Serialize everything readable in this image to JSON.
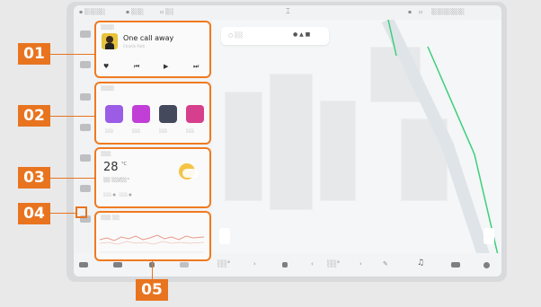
{
  "callouts": [
    "01",
    "02",
    "03",
    "04",
    "05"
  ],
  "music": {
    "song_title": "One call away",
    "artist": "Charlie Puth",
    "controls": [
      "like-icon",
      "prev-icon",
      "play-icon",
      "next-icon"
    ]
  },
  "weather": {
    "temperature": "28",
    "unit": "°C"
  },
  "colors": {
    "callout": "#e8741f",
    "app1": "#9b5de5",
    "app2": "#c13fd6",
    "app3": "#444a5c",
    "app4": "#d63f8c",
    "route": "#3ccf7b"
  }
}
